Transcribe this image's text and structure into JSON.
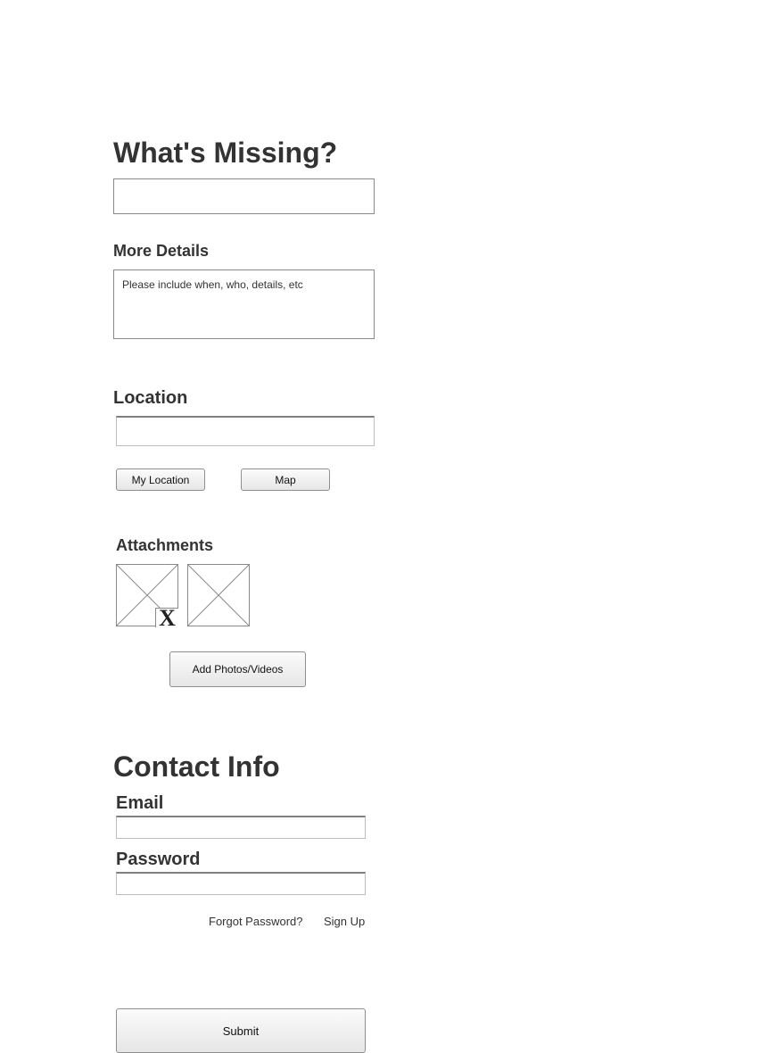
{
  "missing": {
    "title": "What's Missing?",
    "title_value": ""
  },
  "details": {
    "label": "More Details",
    "placeholder": "Please include when, who, details, etc"
  },
  "location": {
    "label": "Location",
    "value": "",
    "my_location_button": "My Location",
    "map_button": "Map"
  },
  "attachments": {
    "label": "Attachments",
    "items": [
      {
        "icon": "image-placeholder-icon",
        "removable": true,
        "remove_label": "X"
      },
      {
        "icon": "image-placeholder-icon",
        "removable": false
      }
    ],
    "add_button": "Add Photos/Videos"
  },
  "contact": {
    "title": "Contact Info",
    "email_label": "Email",
    "email_value": "",
    "password_label": "Password",
    "password_value": "",
    "forgot_link": "Forgot Password?",
    "signup_link": "Sign Up"
  },
  "submit_button": "Submit"
}
